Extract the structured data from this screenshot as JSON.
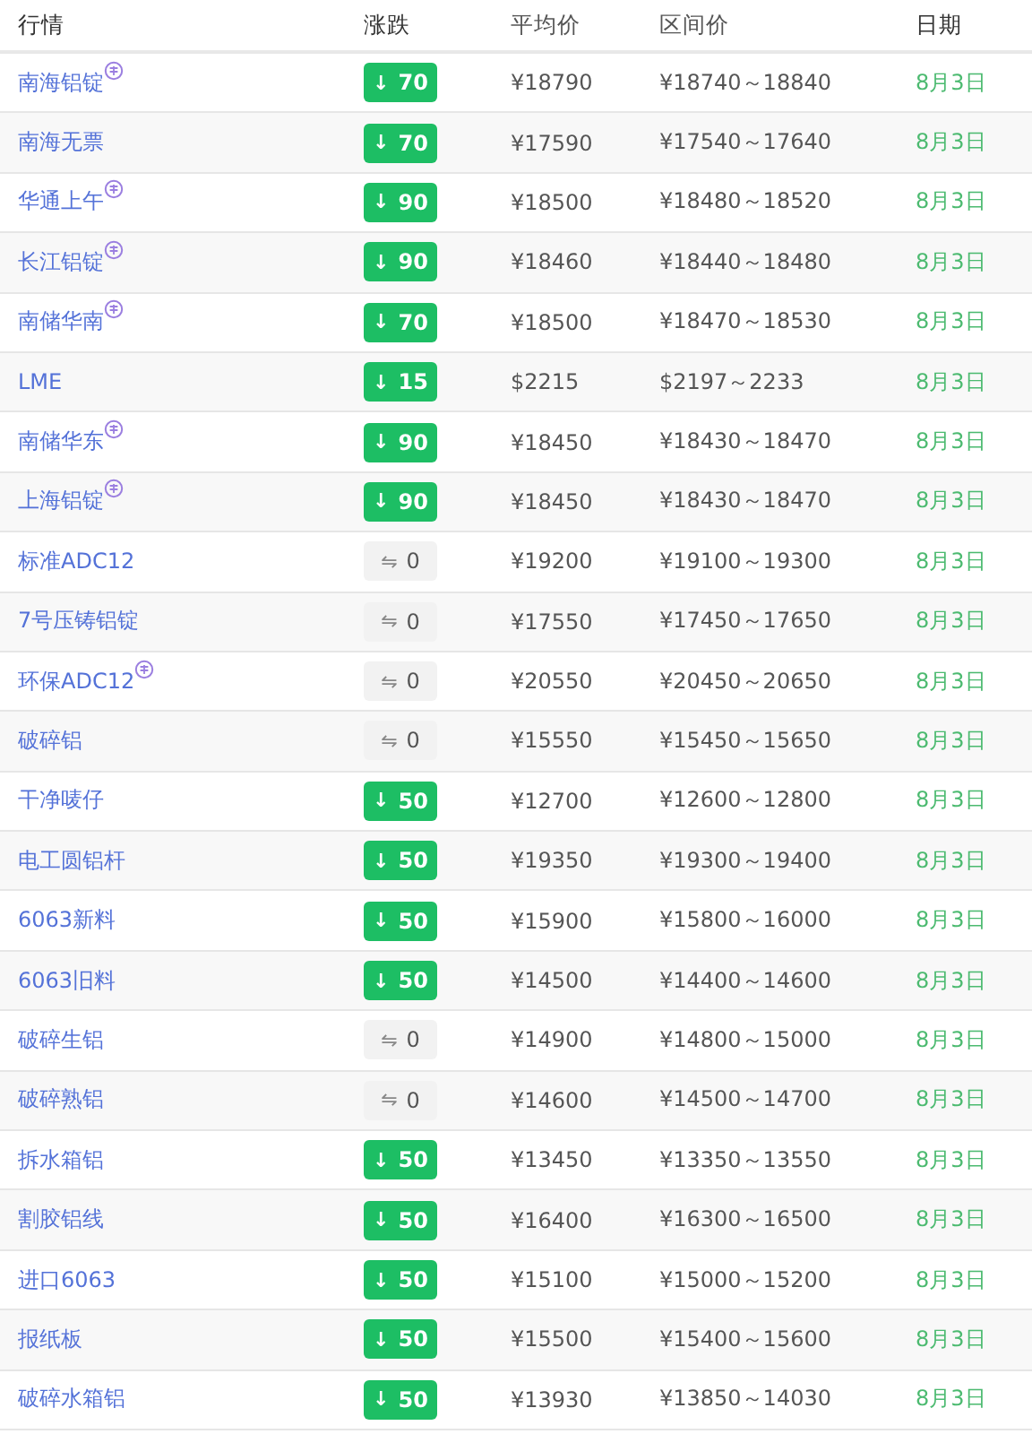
{
  "table": {
    "columns": [
      "行情",
      "涨跌",
      "平均价",
      "区间价",
      "日期"
    ],
    "rows": [
      {
        "name": "南海铝锭",
        "marked": true,
        "change": {
          "kind": "down",
          "arrow": "↓",
          "value": "70"
        },
        "average": "¥18790",
        "range": "¥18740～18840",
        "date": "8月3日"
      },
      {
        "name": "南海无票",
        "marked": false,
        "change": {
          "kind": "down",
          "arrow": "↓",
          "value": "70"
        },
        "average": "¥17590",
        "range": "¥17540～17640",
        "date": "8月3日"
      },
      {
        "name": "华通上午",
        "marked": true,
        "change": {
          "kind": "down",
          "arrow": "↓",
          "value": "90"
        },
        "average": "¥18500",
        "range": "¥18480～18520",
        "date": "8月3日"
      },
      {
        "name": "长江铝锭",
        "marked": true,
        "change": {
          "kind": "down",
          "arrow": "↓",
          "value": "90"
        },
        "average": "¥18460",
        "range": "¥18440～18480",
        "date": "8月3日"
      },
      {
        "name": "南储华南",
        "marked": true,
        "change": {
          "kind": "down",
          "arrow": "↓",
          "value": "70"
        },
        "average": "¥18500",
        "range": "¥18470～18530",
        "date": "8月3日"
      },
      {
        "name": "LME",
        "marked": false,
        "change": {
          "kind": "down",
          "arrow": "↓",
          "value": "15"
        },
        "average": "$2215",
        "range": "$2197～2233",
        "date": "8月3日"
      },
      {
        "name": "南储华东",
        "marked": true,
        "change": {
          "kind": "down",
          "arrow": "↓",
          "value": "90"
        },
        "average": "¥18450",
        "range": "¥18430～18470",
        "date": "8月3日"
      },
      {
        "name": "上海铝锭",
        "marked": true,
        "change": {
          "kind": "down",
          "arrow": "↓",
          "value": "90"
        },
        "average": "¥18450",
        "range": "¥18430～18470",
        "date": "8月3日"
      },
      {
        "name": "标准ADC12",
        "marked": false,
        "change": {
          "kind": "flat",
          "arrow": "⇋",
          "value": "0"
        },
        "average": "¥19200",
        "range": "¥19100～19300",
        "date": "8月3日"
      },
      {
        "name": "7号压铸铝锭",
        "marked": false,
        "change": {
          "kind": "flat",
          "arrow": "⇋",
          "value": "0"
        },
        "average": "¥17550",
        "range": "¥17450～17650",
        "date": "8月3日"
      },
      {
        "name": "环保ADC12",
        "marked": true,
        "change": {
          "kind": "flat",
          "arrow": "⇋",
          "value": "0"
        },
        "average": "¥20550",
        "range": "¥20450～20650",
        "date": "8月3日"
      },
      {
        "name": "破碎铝",
        "marked": false,
        "change": {
          "kind": "flat",
          "arrow": "⇋",
          "value": "0"
        },
        "average": "¥15550",
        "range": "¥15450～15650",
        "date": "8月3日"
      },
      {
        "name": "干净唛仔",
        "marked": false,
        "change": {
          "kind": "down",
          "arrow": "↓",
          "value": "50"
        },
        "average": "¥12700",
        "range": "¥12600～12800",
        "date": "8月3日"
      },
      {
        "name": "电工圆铝杆",
        "marked": false,
        "change": {
          "kind": "down",
          "arrow": "↓",
          "value": "50"
        },
        "average": "¥19350",
        "range": "¥19300～19400",
        "date": "8月3日"
      },
      {
        "name": "6063新料",
        "marked": false,
        "change": {
          "kind": "down",
          "arrow": "↓",
          "value": "50"
        },
        "average": "¥15900",
        "range": "¥15800～16000",
        "date": "8月3日"
      },
      {
        "name": "6063旧料",
        "marked": false,
        "change": {
          "kind": "down",
          "arrow": "↓",
          "value": "50"
        },
        "average": "¥14500",
        "range": "¥14400～14600",
        "date": "8月3日"
      },
      {
        "name": "破碎生铝",
        "marked": false,
        "change": {
          "kind": "flat",
          "arrow": "⇋",
          "value": "0"
        },
        "average": "¥14900",
        "range": "¥14800～15000",
        "date": "8月3日"
      },
      {
        "name": "破碎熟铝",
        "marked": false,
        "change": {
          "kind": "flat",
          "arrow": "⇋",
          "value": "0"
        },
        "average": "¥14600",
        "range": "¥14500～14700",
        "date": "8月3日"
      },
      {
        "name": "拆水箱铝",
        "marked": false,
        "change": {
          "kind": "down",
          "arrow": "↓",
          "value": "50"
        },
        "average": "¥13450",
        "range": "¥13350～13550",
        "date": "8月3日"
      },
      {
        "name": "割胶铝线",
        "marked": false,
        "change": {
          "kind": "down",
          "arrow": "↓",
          "value": "50"
        },
        "average": "¥16400",
        "range": "¥16300～16500",
        "date": "8月3日"
      },
      {
        "name": "进口6063",
        "marked": false,
        "change": {
          "kind": "down",
          "arrow": "↓",
          "value": "50"
        },
        "average": "¥15100",
        "range": "¥15000～15200",
        "date": "8月3日"
      },
      {
        "name": "报纸板",
        "marked": false,
        "change": {
          "kind": "down",
          "arrow": "↓",
          "value": "50"
        },
        "average": "¥15500",
        "range": "¥15400～15600",
        "date": "8月3日"
      },
      {
        "name": "破碎水箱铝",
        "marked": false,
        "change": {
          "kind": "down",
          "arrow": "↓",
          "value": "50"
        },
        "average": "¥13930",
        "range": "¥13850～14030",
        "date": "8月3日"
      }
    ]
  }
}
